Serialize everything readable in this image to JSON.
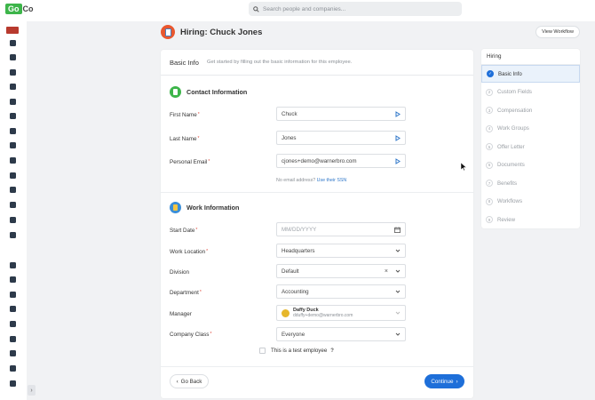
{
  "app": {
    "logo_go": "Go",
    "logo_co": "Co",
    "search_placeholder": "Search people and companies..."
  },
  "sidebar_icons": [
    "people-icon",
    "building-icon",
    "org-chart-icon",
    "umbrella-icon",
    "sync-icon",
    "plane-icon",
    "clock-icon",
    "document-icon",
    "calendar-icon",
    "chart-icon",
    "chat-icon",
    "upload-icon",
    "star-icon",
    "grid-icon",
    "monitor-icon",
    "office-icon",
    "user-switch-icon",
    "dollar-icon",
    "refresh-icon",
    "book-icon",
    "bar-chart-icon",
    "handshake-icon",
    "workflow-icon"
  ],
  "header": {
    "title": "Hiring: Chuck Jones",
    "view_workflow": "View Workflow"
  },
  "basic_info": {
    "title": "Basic Info",
    "subtitle": "Get started by filling out the basic information for this employee."
  },
  "contact": {
    "title": "Contact Information",
    "first_name_label": "First Name",
    "first_name_value": "Chuck",
    "last_name_label": "Last Name",
    "last_name_value": "Jones",
    "email_label": "Personal Email",
    "email_value": "cjones+demo@warnerbro.com",
    "no_email_text": "No email address?",
    "use_ssn_link": "Use their SSN"
  },
  "work": {
    "title": "Work Information",
    "start_date_label": "Start Date",
    "start_date_placeholder": "MM/DD/YYYY",
    "location_label": "Work Location",
    "location_value": "Headquarters",
    "division_label": "Division",
    "division_value": "Default",
    "department_label": "Department",
    "department_value": "Accounting",
    "manager_label": "Manager",
    "manager_name": "Daffy Duck",
    "manager_email": "dduffy+demo@warnerbro.com",
    "company_class_label": "Company Class",
    "company_class_value": "Everyone",
    "test_employee_label": "This is a test employee",
    "help_mark": "?"
  },
  "footer": {
    "go_back": "Go Back",
    "continue": "Continue"
  },
  "steps": {
    "title": "Hiring",
    "items": [
      {
        "num": "✓",
        "label": "Basic Info"
      },
      {
        "num": "2",
        "label": "Custom Fields"
      },
      {
        "num": "3",
        "label": "Compensation"
      },
      {
        "num": "4",
        "label": "Work Groups"
      },
      {
        "num": "5",
        "label": "Offer Letter"
      },
      {
        "num": "6",
        "label": "Documents"
      },
      {
        "num": "7",
        "label": "Benefits"
      },
      {
        "num": "8",
        "label": "Workflows"
      },
      {
        "num": "9",
        "label": "Review"
      }
    ]
  },
  "colors": {
    "brand_green": "#3db54a",
    "primary_blue": "#1e6fd9",
    "required_red": "#e0483b"
  }
}
